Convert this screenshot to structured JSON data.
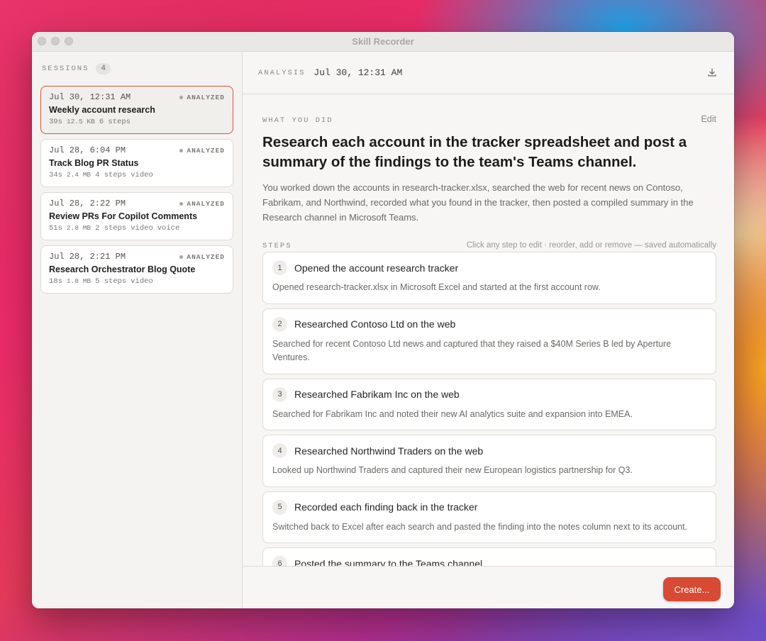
{
  "window": {
    "title": "Skill Recorder"
  },
  "sidebar": {
    "heading": "SESSIONS",
    "count": "4",
    "sessions": [
      {
        "date": "Jul 30, 12:31 AM",
        "status": "ANALYZED",
        "title": "Weekly account research",
        "duration": "39s",
        "size": "12.5 KB",
        "steps": "6 steps",
        "tags": []
      },
      {
        "date": "Jul 28, 6:04 PM",
        "status": "ANALYZED",
        "title": "Track Blog PR Status",
        "duration": "34s",
        "size": "2.4 MB",
        "steps": "4 steps",
        "tags": [
          "video"
        ]
      },
      {
        "date": "Jul 28, 2:22 PM",
        "status": "ANALYZED",
        "title": "Review PRs For Copilot Comments",
        "duration": "51s",
        "size": "2.8 MB",
        "steps": "2 steps",
        "tags": [
          "video",
          "voice"
        ]
      },
      {
        "date": "Jul 28, 2:21 PM",
        "status": "ANALYZED",
        "title": "Research Orchestrator Blog Quote",
        "duration": "18s",
        "size": "1.8 MB",
        "steps": "5 steps",
        "tags": [
          "video"
        ]
      }
    ]
  },
  "main": {
    "header": {
      "label": "ANALYSIS",
      "date": "Jul 30, 12:31 AM"
    },
    "what_you_did": {
      "label": "WHAT YOU DID",
      "edit": "Edit",
      "headline": "Research each account in the tracker spreadsheet and post a summary of the findings to the team's Teams channel.",
      "summary": "You worked down the accounts in research-tracker.xlsx, searched the web for recent news on Contoso, Fabrikam, and Northwind, recorded what you found in the tracker, then posted a compiled summary in the Research channel in Microsoft Teams."
    },
    "steps": {
      "label": "STEPS",
      "hint": "Click any step to edit · reorder, add or remove — saved automatically",
      "items": [
        {
          "num": "1",
          "title": "Opened the account research tracker",
          "desc": "Opened research-tracker.xlsx in Microsoft Excel and started at the first account row."
        },
        {
          "num": "2",
          "title": "Researched Contoso Ltd on the web",
          "desc": "Searched for recent Contoso Ltd news and captured that they raised a $40M Series B led by Aperture Ventures."
        },
        {
          "num": "3",
          "title": "Researched Fabrikam Inc on the web",
          "desc": "Searched for Fabrikam Inc and noted their new AI analytics suite and expansion into EMEA."
        },
        {
          "num": "4",
          "title": "Researched Northwind Traders on the web",
          "desc": "Looked up Northwind Traders and captured their new European logistics partnership for Q3."
        },
        {
          "num": "5",
          "title": "Recorded each finding back in the tracker",
          "desc": "Switched back to Excel after each search and pasted the finding into the notes column next to its account."
        },
        {
          "num": "6",
          "title": "Posted the summary to the Teams channel",
          "desc": ""
        }
      ]
    },
    "footer": {
      "create_label": "Create..."
    }
  },
  "icons": {
    "download": "download-icon"
  },
  "colors": {
    "accent": "#d84a34",
    "selected_border": "#d8533e"
  }
}
